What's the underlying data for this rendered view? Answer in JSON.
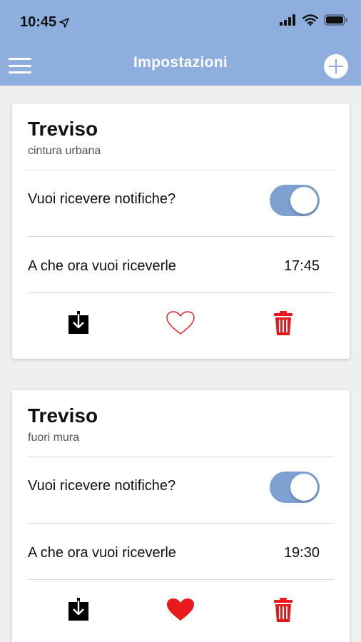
{
  "status_bar": {
    "time": "10:45",
    "icons": [
      "location-arrow-icon",
      "cellular-signal-icon",
      "wifi-icon",
      "battery-icon"
    ]
  },
  "navbar": {
    "title": "Impostazioni",
    "menu_icon": "hamburger-menu-icon",
    "add_icon": "add-circle-icon",
    "background_color": "#8eaedd"
  },
  "cards": [
    {
      "title": "Treviso",
      "subtitle": "cintura urbana",
      "notifications_label": "Vuoi ricevere notifiche?",
      "notifications_enabled": true,
      "time_label": "A che ora vuoi riceverle",
      "time_value": "17:45",
      "actions": {
        "download_icon": "download-icon",
        "favorite_icon": "heart-outline-icon",
        "favorite_active": false,
        "delete_icon": "trash-icon"
      }
    },
    {
      "title": "Treviso",
      "subtitle": "fuori mura",
      "notifications_label": "Vuoi ricevere notifiche?",
      "notifications_enabled": true,
      "time_label": "A che ora vuoi riceverle",
      "time_value": "19:30",
      "actions": {
        "download_icon": "download-icon",
        "favorite_icon": "heart-filled-icon",
        "favorite_active": true,
        "delete_icon": "trash-icon"
      }
    }
  ],
  "colors": {
    "toggle_on": "#7fa1d2",
    "heart": "#e61a1a",
    "trash": "#e61a1a",
    "background": "#efefef"
  }
}
